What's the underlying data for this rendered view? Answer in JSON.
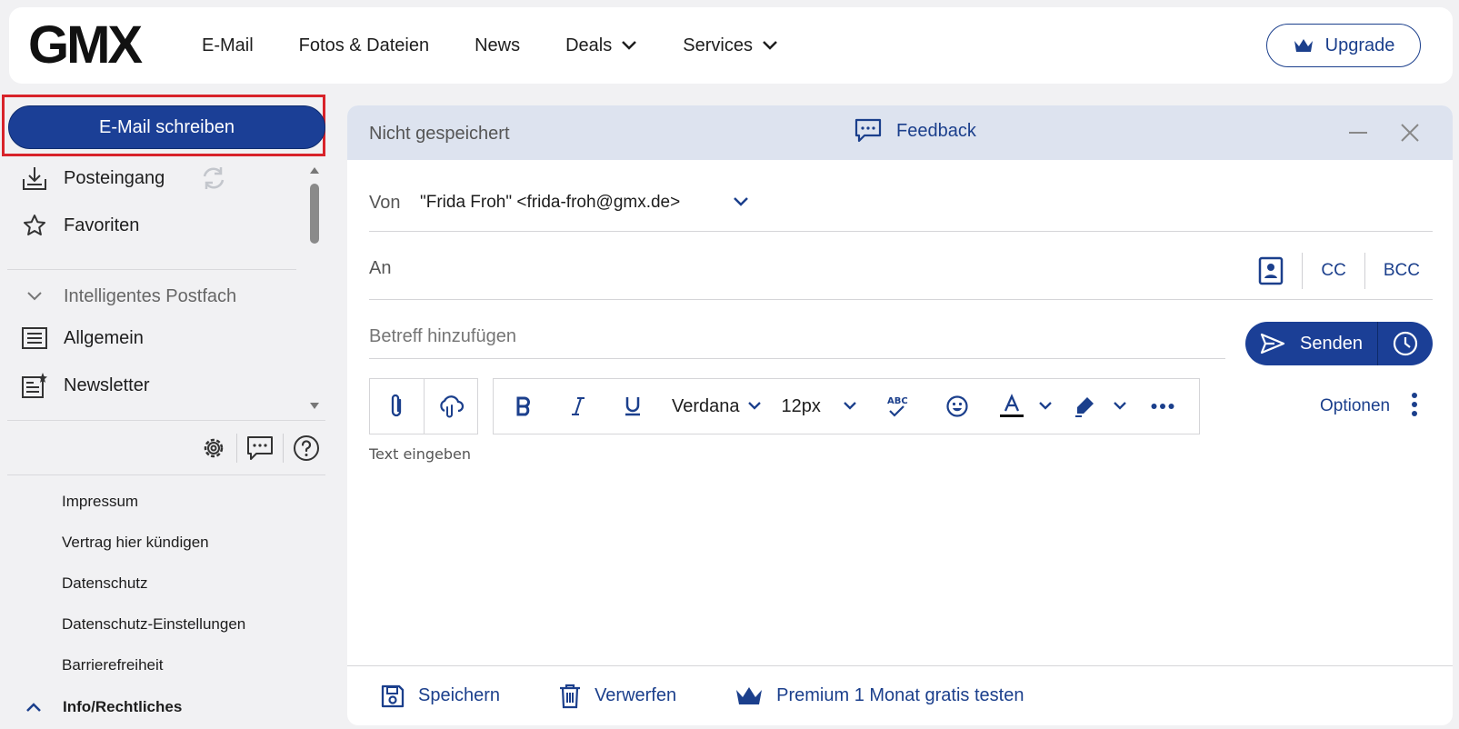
{
  "app": {
    "logo": "GMX"
  },
  "nav": {
    "items": [
      {
        "label": "E-Mail"
      },
      {
        "label": "Fotos & Dateien"
      },
      {
        "label": "News"
      },
      {
        "label": "Deals"
      },
      {
        "label": "Services"
      }
    ],
    "upgrade_label": "Upgrade"
  },
  "sidebar": {
    "write_label": "E-Mail schreiben",
    "folders": [
      {
        "label": "Posteingang",
        "icon": "inbox-icon"
      },
      {
        "label": "Favoriten",
        "icon": "star-icon"
      }
    ],
    "smart_section_label": "Intelligentes Postfach",
    "smart_folders": [
      {
        "label": "Allgemein",
        "icon": "list-icon"
      },
      {
        "label": "Newsletter",
        "icon": "newsletter-icon"
      }
    ],
    "footer_links": [
      "Impressum",
      "Vertrag hier kündigen",
      "Datenschutz",
      "Datenschutz-Einstellungen",
      "Barrierefreiheit"
    ],
    "info_label": "Info/Rechtliches"
  },
  "compose": {
    "status": "Nicht gespeichert",
    "feedback_label": "Feedback",
    "from_label": "Von",
    "from_value": "\"Frida Froh\" <frida-froh@gmx.de>",
    "to_label": "An",
    "cc_label": "CC",
    "bcc_label": "BCC",
    "subject_placeholder": "Betreff hinzufügen",
    "send_label": "Senden",
    "font_family": "Verdana",
    "font_size": "12px",
    "options_label": "Optionen",
    "body_placeholder": "Text eingeben",
    "footer": {
      "save_label": "Speichern",
      "discard_label": "Verwerfen",
      "premium_label": "Premium 1 Monat gratis testen"
    }
  },
  "colors": {
    "brand_blue": "#1b3f96",
    "link_blue": "#1b3f8c",
    "highlight_red": "#d8232a",
    "compose_header": "#dde3ef"
  }
}
